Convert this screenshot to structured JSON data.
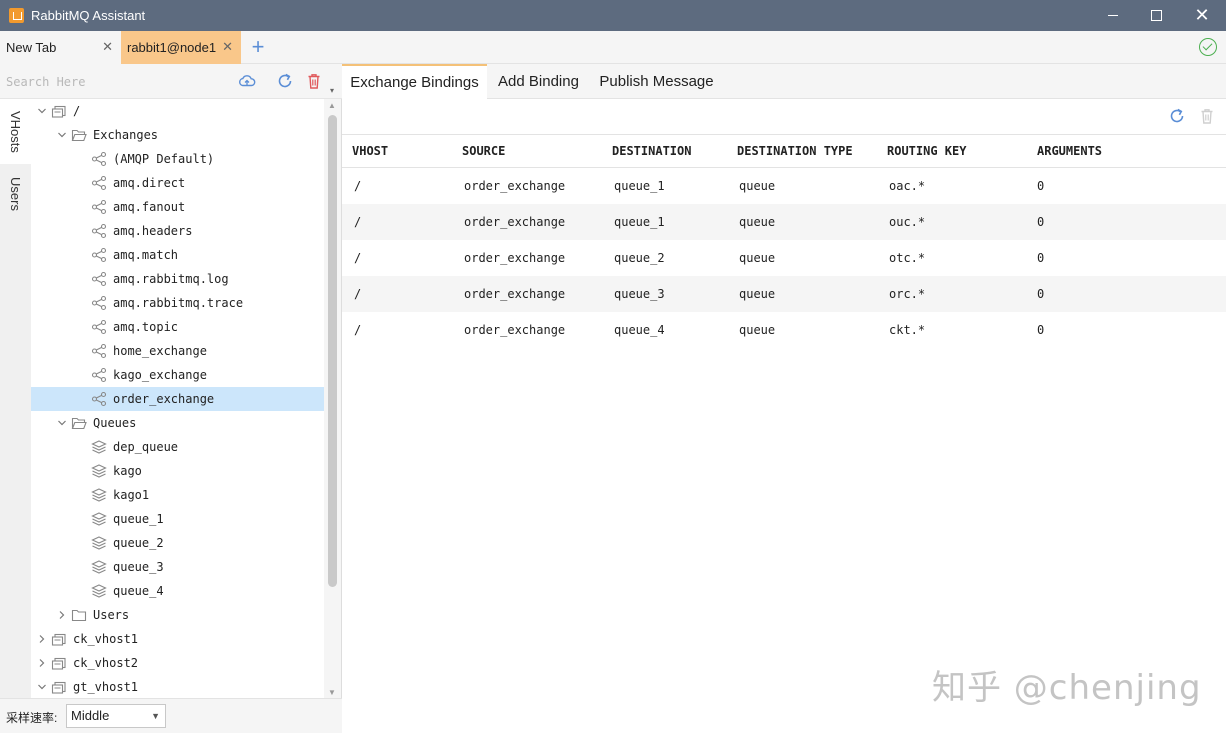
{
  "window": {
    "title": "RabbitMQ Assistant"
  },
  "tabs": [
    {
      "label": "New Tab"
    },
    {
      "label": "rabbit1@node1"
    }
  ],
  "sidebar": {
    "vertical_tabs": [
      "VHosts",
      "Users"
    ],
    "search": {
      "placeholder": "Search Here",
      "value": ""
    },
    "tree": [
      {
        "label": "/",
        "depth": 0,
        "icon": "vhost-icon",
        "expanded": true
      },
      {
        "label": "Exchanges",
        "depth": 1,
        "icon": "folder-open-icon",
        "expanded": true
      },
      {
        "label": "(AMQP Default)",
        "depth": 2,
        "icon": "exchange-icon"
      },
      {
        "label": "amq.direct",
        "depth": 2,
        "icon": "exchange-icon"
      },
      {
        "label": "amq.fanout",
        "depth": 2,
        "icon": "exchange-icon"
      },
      {
        "label": "amq.headers",
        "depth": 2,
        "icon": "exchange-icon"
      },
      {
        "label": "amq.match",
        "depth": 2,
        "icon": "exchange-icon"
      },
      {
        "label": "amq.rabbitmq.log",
        "depth": 2,
        "icon": "exchange-icon"
      },
      {
        "label": "amq.rabbitmq.trace",
        "depth": 2,
        "icon": "exchange-icon"
      },
      {
        "label": "amq.topic",
        "depth": 2,
        "icon": "exchange-icon"
      },
      {
        "label": "home_exchange",
        "depth": 2,
        "icon": "exchange-icon"
      },
      {
        "label": "kago_exchange",
        "depth": 2,
        "icon": "exchange-icon"
      },
      {
        "label": "order_exchange",
        "depth": 2,
        "icon": "exchange-icon",
        "selected": true
      },
      {
        "label": "Queues",
        "depth": 1,
        "icon": "folder-open-icon",
        "expanded": true
      },
      {
        "label": "dep_queue",
        "depth": 2,
        "icon": "queue-icon"
      },
      {
        "label": "kago",
        "depth": 2,
        "icon": "queue-icon"
      },
      {
        "label": "kago1",
        "depth": 2,
        "icon": "queue-icon"
      },
      {
        "label": "queue_1",
        "depth": 2,
        "icon": "queue-icon"
      },
      {
        "label": "queue_2",
        "depth": 2,
        "icon": "queue-icon"
      },
      {
        "label": "queue_3",
        "depth": 2,
        "icon": "queue-icon"
      },
      {
        "label": "queue_4",
        "depth": 2,
        "icon": "queue-icon"
      },
      {
        "label": "Users",
        "depth": 1,
        "icon": "folder-icon",
        "expanded": false
      },
      {
        "label": "ck_vhost1",
        "depth": 0,
        "icon": "vhost-icon",
        "expanded": false
      },
      {
        "label": "ck_vhost2",
        "depth": 0,
        "icon": "vhost-icon",
        "expanded": false
      },
      {
        "label": "gt_vhost1",
        "depth": 0,
        "icon": "vhost-icon",
        "expanded": true
      }
    ],
    "rate": {
      "label": "采样速率:",
      "value": "Middle"
    }
  },
  "content": {
    "tabs": [
      "Exchange Bindings",
      "Add Binding",
      "Publish Message"
    ],
    "active_tab": "Exchange Bindings",
    "table": {
      "columns": [
        "VHOST",
        "SOURCE",
        "DESTINATION",
        "DESTINATION TYPE",
        "ROUTING KEY",
        "ARGUMENTS"
      ],
      "rows": [
        [
          "/",
          "order_exchange",
          "queue_1",
          "queue",
          "oac.*",
          "0"
        ],
        [
          "/",
          "order_exchange",
          "queue_1",
          "queue",
          "ouc.*",
          "0"
        ],
        [
          "/",
          "order_exchange",
          "queue_2",
          "queue",
          "otc.*",
          "0"
        ],
        [
          "/",
          "order_exchange",
          "queue_3",
          "queue",
          "orc.*",
          "0"
        ],
        [
          "/",
          "order_exchange",
          "queue_4",
          "queue",
          "ckt.*",
          "0"
        ]
      ]
    }
  },
  "watermark": "知乎 @chenjing",
  "colors": {
    "titlebar": "#5d6b7f",
    "active_tab": "#f9c78a",
    "selected_row": "#cce6fb",
    "accent_blue": "#5b8ed6",
    "delete_red": "#e0585b",
    "connected_green": "#4caf50"
  }
}
